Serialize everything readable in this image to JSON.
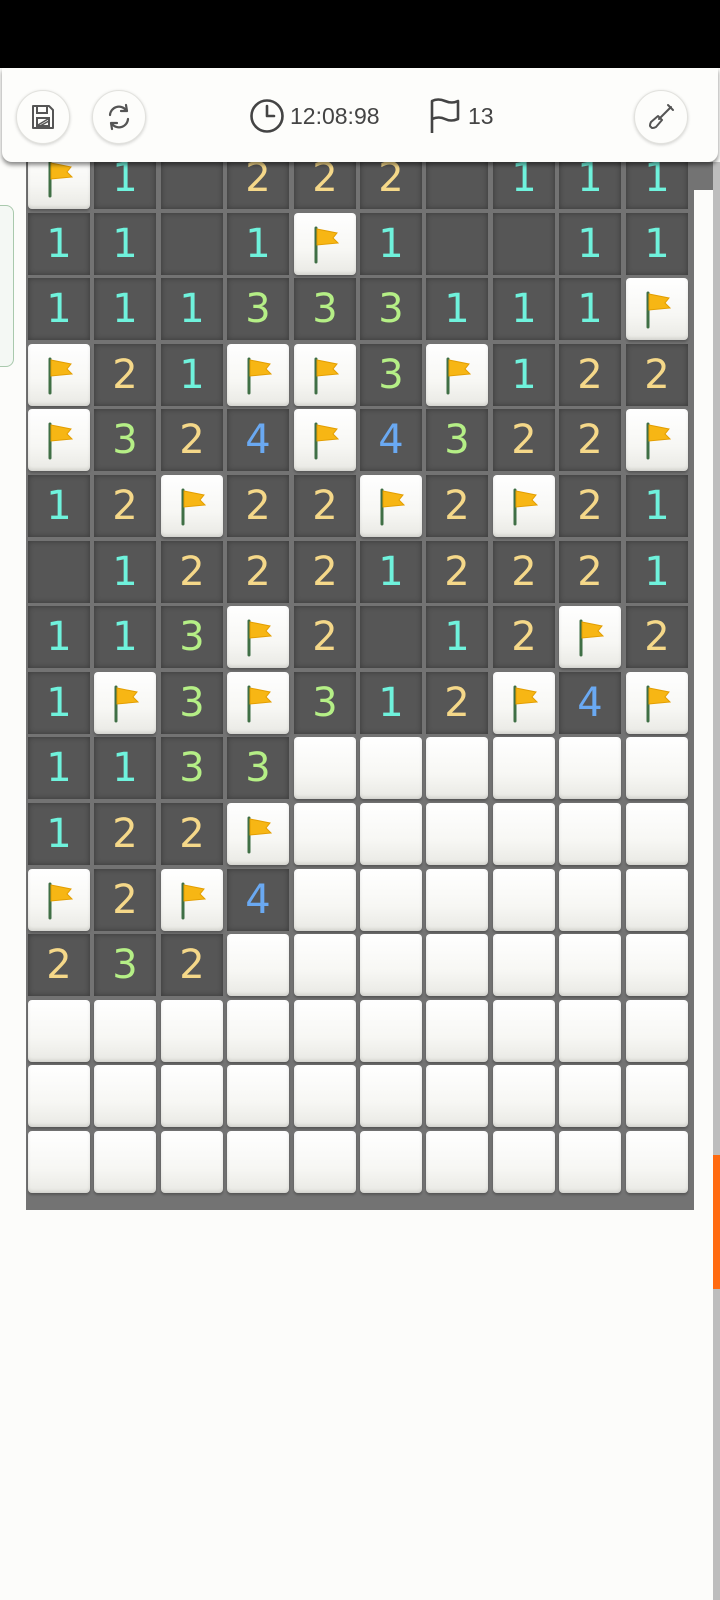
{
  "toolbar": {
    "timer": "12:08:98",
    "flags_remaining": "13",
    "icons": {
      "save": "save-icon",
      "restart": "restart-icon",
      "timer": "clock-icon",
      "flag": "flag-icon",
      "shovel": "shovel-icon"
    }
  },
  "colors": {
    "n1": "#6ff2dc",
    "n2": "#f5d889",
    "n3": "#b5ef86",
    "n4": "#6aa9f2",
    "flag": "#f7b614",
    "scroll_thumb": "#ff6a10"
  },
  "board": {
    "legend": "C = covered, F = flagged, 0 = open empty, digit = open number",
    "rows": [
      "F10222011 1",
      "1101F1001 1",
      "1113331 11F",
      "F21FF3F122",
      "F324F4322F",
      "12F22F2F21",
      "0122212221",
      "113F201 2F2",
      "1F3F312F4F",
      "1133CCCCCC",
      "122FCCCCCC",
      "F2F4CCCCCC",
      "232CCCCCCC",
      "CCCCCCCCCC",
      "CCCCCCCCCC",
      "CCCCCCCCCC"
    ]
  }
}
